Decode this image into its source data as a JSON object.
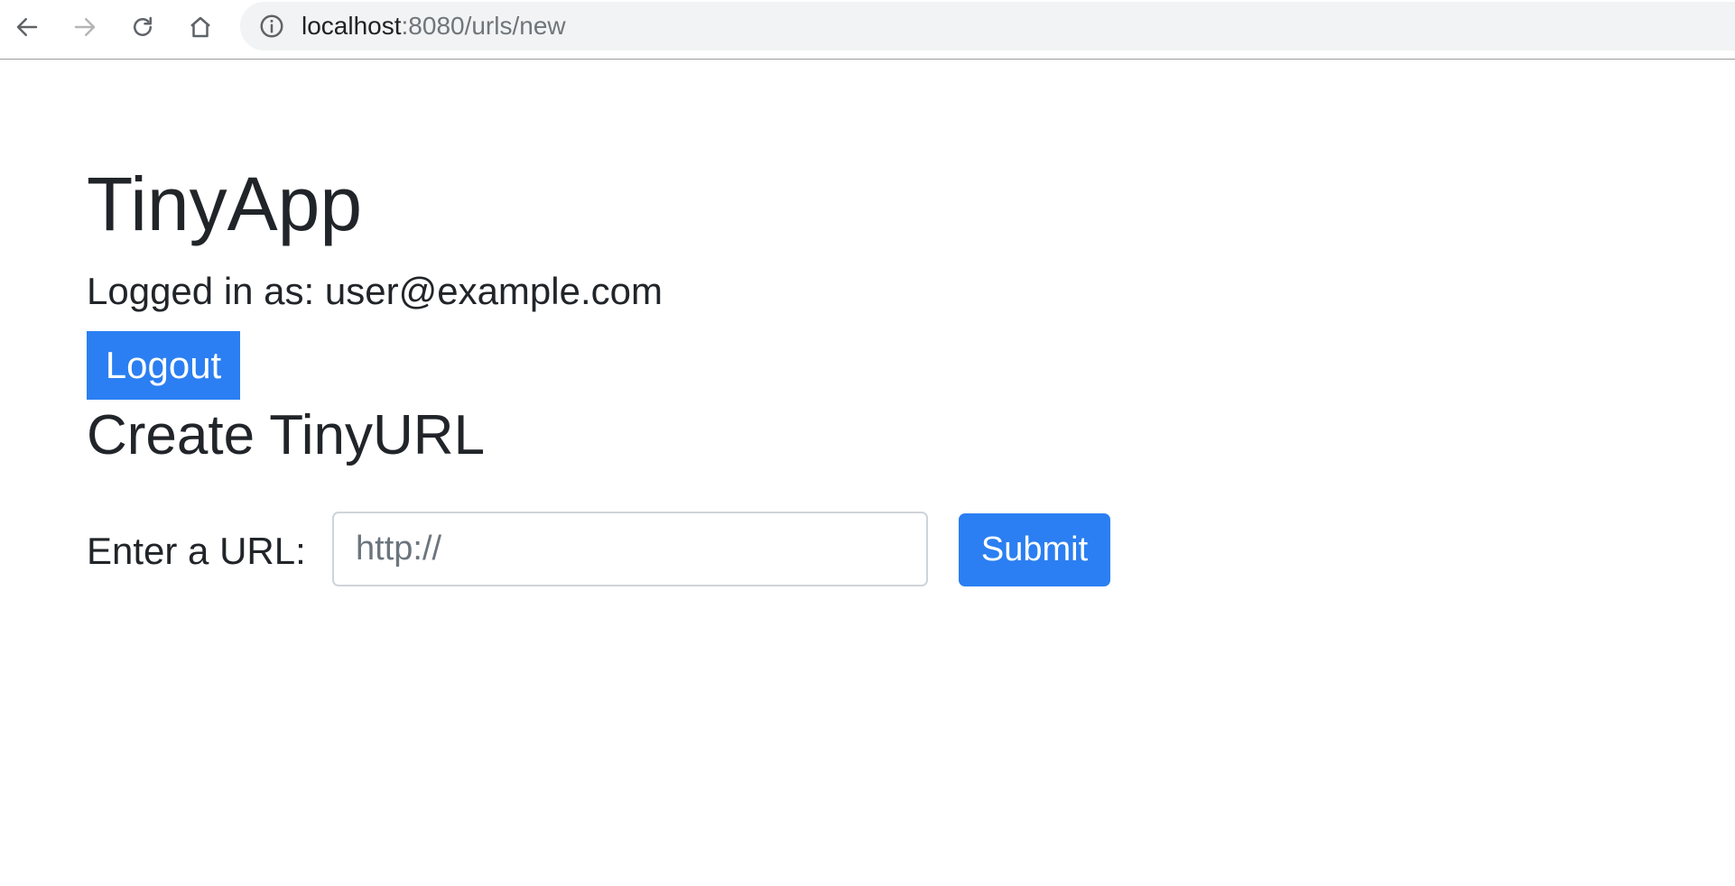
{
  "browser": {
    "url_host": "localhost",
    "url_rest": ":8080/urls/new",
    "icons": {
      "back": "back-arrow-icon",
      "forward": "forward-arrow-icon",
      "reload": "reload-icon",
      "home": "home-icon",
      "info": "info-icon"
    }
  },
  "page": {
    "app_title": "TinyApp",
    "logged_in_text": "Logged in as: user@example.com",
    "logout_label": "Logout",
    "create_heading": "Create TinyURL",
    "form": {
      "label": "Enter a URL:",
      "input_placeholder": "http://",
      "input_value": "",
      "submit_label": "Submit"
    }
  },
  "colors": {
    "primary": "#2b7ff2",
    "text": "#212529",
    "muted": "#6c757d",
    "omnibox_bg": "#f1f3f4"
  }
}
